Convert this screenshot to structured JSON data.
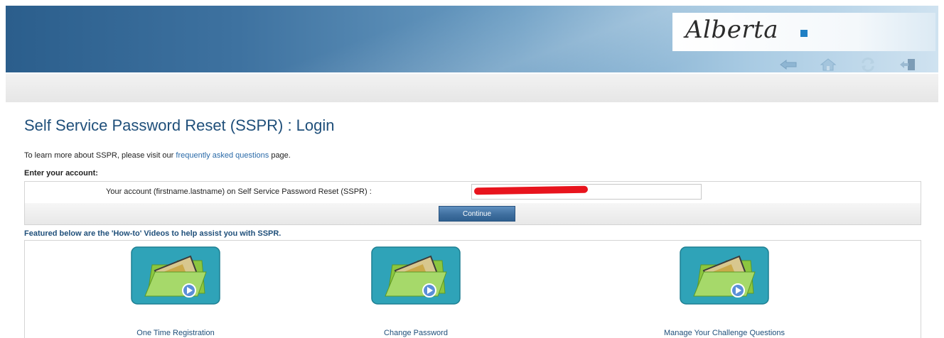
{
  "header": {
    "logo_text": "Alberta",
    "nav_icons": [
      "back-icon",
      "home-icon",
      "refresh-icon",
      "logout-icon"
    ]
  },
  "page": {
    "title": "Self Service Password Reset (SSPR) : Login",
    "info_prefix": "To learn more about SSPR, please visit our ",
    "info_link": "frequently asked questions",
    "info_suffix": " page."
  },
  "account": {
    "section_label": "Enter your account:",
    "field_label": "Your account (firstname.lastname) on Self Service Password Reset (SSPR) :",
    "field_value": ""
  },
  "actions": {
    "continue_label": "Continue"
  },
  "videos": {
    "heading": "Featured below are the 'How-to' Videos to help assist you with SSPR.",
    "items": [
      {
        "label": "One Time Registration",
        "icon": "video-folder-icon"
      },
      {
        "label": "Change Password",
        "icon": "video-folder-icon"
      },
      {
        "label": "Manage Your Challenge Questions",
        "icon": "video-folder-icon"
      }
    ]
  },
  "colors": {
    "title": "#1f4f7a",
    "link": "#2a6aa8",
    "button": "#3f6f9f",
    "redaction": "#e8141d"
  }
}
